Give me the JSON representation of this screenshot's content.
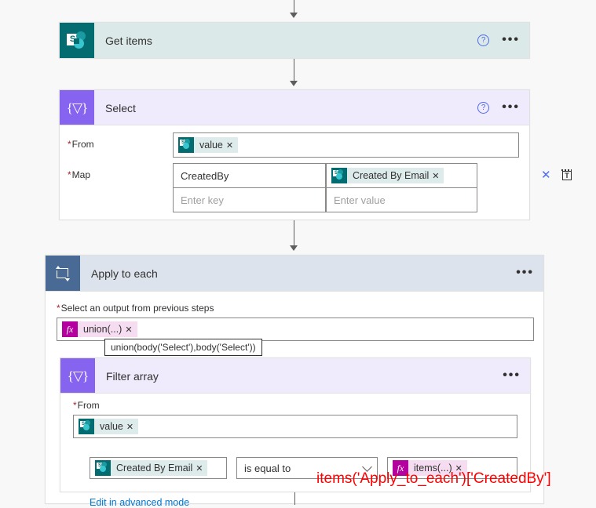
{
  "canvas": {
    "background": "#f8f8f8",
    "annotation": "items('Apply_to_each')['CreatedBy']",
    "annotation_color": "#ff0000"
  },
  "colors": {
    "sharepoint_teal": "#036c70",
    "data_op_purple": "#8764f0",
    "loop_slate": "#4a6a96",
    "expression_magenta": "#b4009e",
    "link_blue": "#0078d4",
    "required_red": "#a4262c"
  },
  "steps": [
    {
      "id": "get-items",
      "title": "Get items",
      "icon": "sharepoint-icon",
      "help_icon": "?",
      "more_icon": "•••",
      "collapsed": true
    },
    {
      "id": "select",
      "title": "Select",
      "icon": "data-operation-icon",
      "help_icon": "?",
      "more_icon": "•••",
      "fields": {
        "from": {
          "label": "From",
          "required": true,
          "token": {
            "text": "value",
            "icon": "sharepoint-icon",
            "remove": "✕"
          }
        },
        "map": {
          "label": "Map",
          "required": true,
          "rows": [
            {
              "key_value": "CreatedBy",
              "key_placeholder": "",
              "value_token": {
                "text": "Created By Email",
                "icon": "sharepoint-icon",
                "remove": "✕"
              },
              "delete_icon": "✕",
              "text_mode_icon": "switch-to-text-mode-icon"
            },
            {
              "key_value": "",
              "key_placeholder": "Enter key",
              "value_placeholder": "Enter value"
            }
          ]
        }
      }
    },
    {
      "id": "apply-to-each",
      "title": "Apply to each",
      "icon": "loop-icon",
      "more_icon": "•••",
      "fields": {
        "select_output": {
          "label": "Select an output from previous steps",
          "required": true,
          "token": {
            "text": "union(...)",
            "icon": "fx-icon",
            "remove": "✕"
          },
          "tooltip": "union(body('Select'),body('Select'))"
        }
      },
      "children": [
        {
          "id": "filter-array",
          "title": "Filter array",
          "icon": "data-operation-icon",
          "more_icon": "•••",
          "fields": {
            "from": {
              "label": "From",
              "required": true,
              "token": {
                "text": "value",
                "icon": "sharepoint-icon",
                "remove": "✕"
              }
            },
            "condition": {
              "left_token": {
                "text": "Created By Email",
                "icon": "sharepoint-icon",
                "remove": "✕"
              },
              "operator": "is equal to",
              "operator_chevron": "chevron-down-icon",
              "right_token": {
                "text": "items(...)",
                "icon": "fx-icon",
                "remove": "✕"
              }
            },
            "advanced_link": "Edit in advanced mode"
          }
        }
      ]
    }
  ]
}
